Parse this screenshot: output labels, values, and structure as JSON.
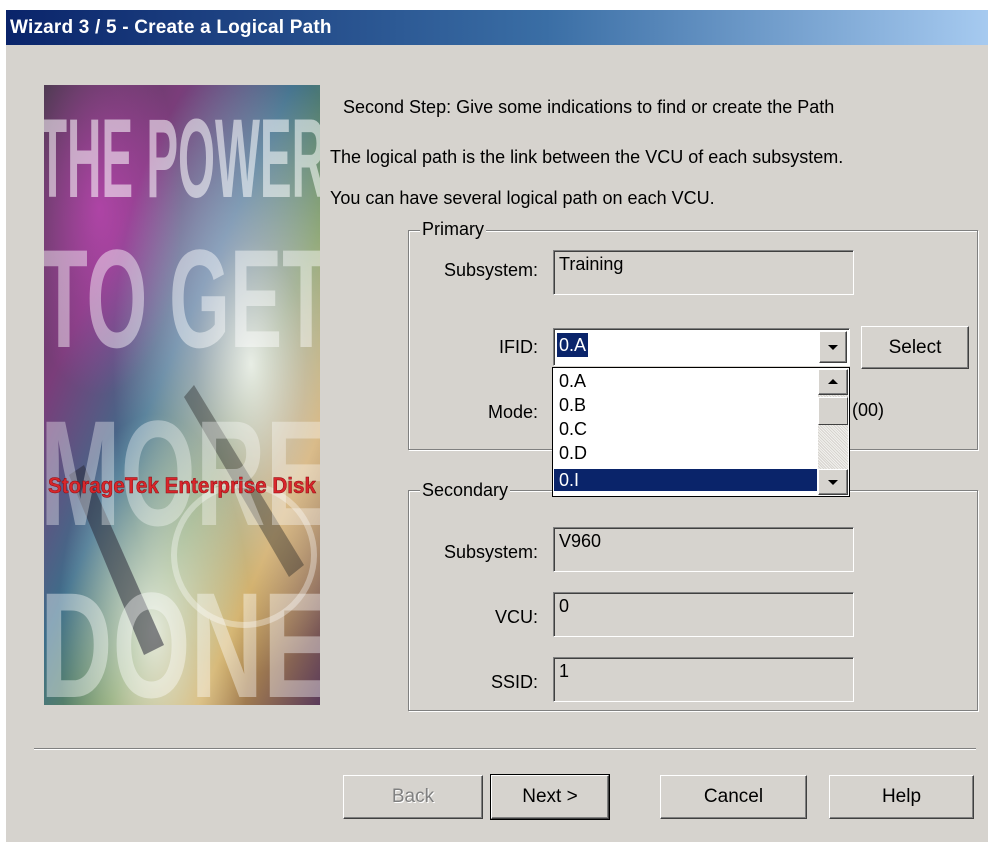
{
  "window": {
    "title": "Wizard 3 / 5 -  Create a Logical Path"
  },
  "banner": {
    "big_text": [
      "THE POWER",
      "TO GET",
      "MORE",
      "DONE"
    ],
    "brand_text": "StorageTek Enterprise Disk"
  },
  "intro": {
    "line1": "Second Step: Give some indications to find or create the Path",
    "line2": "The logical path is the link between the VCU of each subsystem.",
    "line3": "You can have several logical path on each VCU."
  },
  "primary": {
    "legend": "Primary",
    "subsystem_label": "Subsystem:",
    "subsystem_value": "Training",
    "ifid_label": "IFID:",
    "ifid_value": "0.A",
    "select_button": "Select",
    "mode_label": "Mode:",
    "mode_suffix": "(00)",
    "ifid_options": [
      "0.A",
      "0.B",
      "0.C",
      "0.D",
      "0.I"
    ],
    "ifid_highlighted": "0.I"
  },
  "secondary": {
    "legend": "Secondary",
    "subsystem_label": "Subsystem:",
    "subsystem_value": "V960",
    "vcu_label": "VCU:",
    "vcu_value": "0",
    "ssid_label": "SSID:",
    "ssid_value": "1"
  },
  "buttons": {
    "back": "Back",
    "next": "Next >",
    "cancel": "Cancel",
    "help": "Help"
  },
  "colors": {
    "title_start": "#0a246a",
    "title_end": "#a6caf0",
    "dialog_bg": "#d6d3ce",
    "highlight": "#0a246a",
    "brand_red": "#d8262b"
  }
}
